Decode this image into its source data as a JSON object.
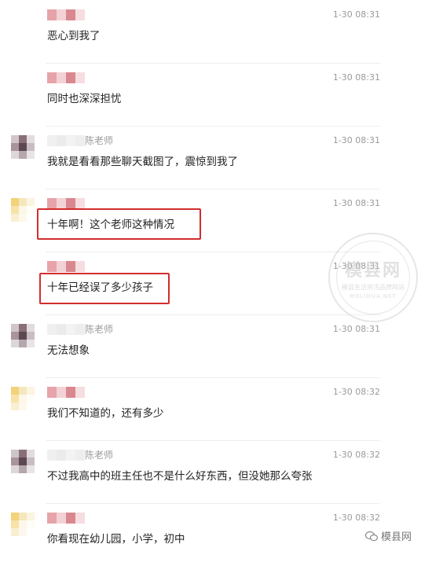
{
  "comments": [
    {
      "time": "1-30 08:31",
      "text": "恶心到我了",
      "name": "",
      "avatar": false
    },
    {
      "time": "1-30 08:31",
      "text": "同时也深深担忧",
      "name": "",
      "avatar": false
    },
    {
      "time": "1-30 08:31",
      "text": "我就是看看那些聊天截图了，震惊到我了",
      "name": "陈老师",
      "avatar": true
    },
    {
      "time": "1-30 08:31",
      "text": "十年啊！这个老师这种情况",
      "name": "",
      "avatar": true
    },
    {
      "time": "1-30 08:31",
      "text": "十年已经误了多少孩子",
      "name": "",
      "avatar": false
    },
    {
      "time": "1-30 08:31",
      "text": "无法想象",
      "name": "陈老师",
      "avatar": true
    },
    {
      "time": "1-30 08:32",
      "text": "我们不知道的，还有多少",
      "name": "",
      "avatar": true
    },
    {
      "time": "1-30 08:32",
      "text": "不过我高中的班主任也不是什么好东西，但没她那么夸张",
      "name": "陈老师",
      "avatar": true
    },
    {
      "time": "1-30 08:32",
      "text": "你看现在幼儿园，小学，初中",
      "name": "",
      "avatar": true
    }
  ],
  "watermark": {
    "title": "模县网",
    "subtitle": "模县生活资讯品牌网站",
    "en": "MOLIHUA.NET"
  },
  "footer": {
    "brand": "模县网"
  },
  "colors": {
    "highlight": "#d22d2d",
    "meta": "#9a9a9a",
    "text": "#222222"
  }
}
